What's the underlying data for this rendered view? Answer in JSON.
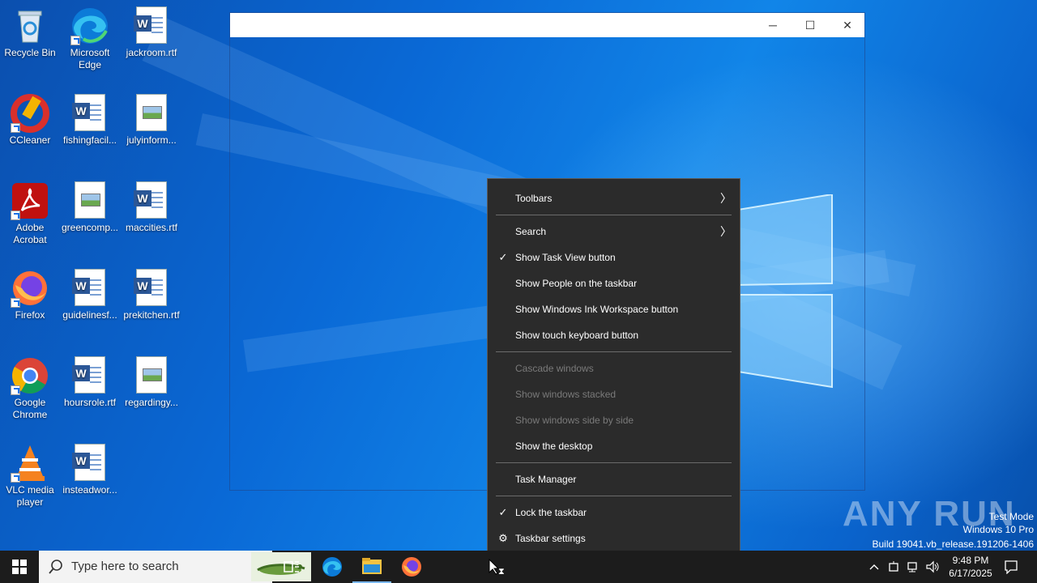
{
  "desktop": {
    "icons": [
      {
        "label": "Recycle Bin",
        "icon": "recycle-bin-icon"
      },
      {
        "label": "Microsoft Edge",
        "icon": "edge-icon"
      },
      {
        "label": "jackroom.rtf",
        "icon": "word-document-icon"
      },
      {
        "label": "CCleaner",
        "icon": "ccleaner-icon"
      },
      {
        "label": "fishingfacil...",
        "icon": "word-document-icon"
      },
      {
        "label": "julyinform...",
        "icon": "image-file-icon"
      },
      {
        "label": "Adobe Acrobat",
        "icon": "acrobat-icon"
      },
      {
        "label": "greencomp...",
        "icon": "image-file-icon"
      },
      {
        "label": "maccities.rtf",
        "icon": "word-document-icon"
      },
      {
        "label": "Firefox",
        "icon": "firefox-icon"
      },
      {
        "label": "guidelinesf...",
        "icon": "word-document-icon"
      },
      {
        "label": "prekitchen.rtf",
        "icon": "word-document-icon"
      },
      {
        "label": "Google Chrome",
        "icon": "chrome-icon"
      },
      {
        "label": "hoursrole.rtf",
        "icon": "word-document-icon"
      },
      {
        "label": "regardingy...",
        "icon": "image-file-icon"
      },
      {
        "label": "VLC media player",
        "icon": "vlc-icon"
      },
      {
        "label": "insteadwor...",
        "icon": "word-document-icon"
      }
    ]
  },
  "window": {
    "minimize_glyph": "─",
    "maximize_glyph": "☐",
    "close_glyph": "✕"
  },
  "context_menu": {
    "items": [
      {
        "label": "Toolbars",
        "submenu": true,
        "checked": false,
        "disabled": false
      },
      {
        "label": "Search",
        "submenu": true,
        "checked": false,
        "disabled": false
      },
      {
        "label": "Show Task View button",
        "submenu": false,
        "checked": true,
        "disabled": false
      },
      {
        "label": "Show People on the taskbar",
        "submenu": false,
        "checked": false,
        "disabled": false
      },
      {
        "label": "Show Windows Ink Workspace button",
        "submenu": false,
        "checked": false,
        "disabled": false
      },
      {
        "label": "Show touch keyboard button",
        "submenu": false,
        "checked": false,
        "disabled": false
      },
      {
        "label": "Cascade windows",
        "submenu": false,
        "checked": false,
        "disabled": true
      },
      {
        "label": "Show windows stacked",
        "submenu": false,
        "checked": false,
        "disabled": true
      },
      {
        "label": "Show windows side by side",
        "submenu": false,
        "checked": false,
        "disabled": true
      },
      {
        "label": "Show the desktop",
        "submenu": false,
        "checked": false,
        "disabled": false
      },
      {
        "label": "Task Manager",
        "submenu": false,
        "checked": false,
        "disabled": false
      },
      {
        "label": "Lock the taskbar",
        "submenu": false,
        "checked": true,
        "disabled": false
      },
      {
        "label": "Taskbar settings",
        "submenu": false,
        "checked": false,
        "disabled": false
      }
    ],
    "check_glyph": "✓",
    "arrow_glyph": "〉",
    "gear_glyph": "⚙"
  },
  "watermark": {
    "brand": "ANY RUN",
    "line1": "Test Mode",
    "line2": "Windows 10 Pro",
    "line3": "Build 19041.vb_release.191206-1406"
  },
  "taskbar": {
    "search_placeholder": "Type here to search",
    "time": "9:48 PM",
    "date": "6/17/2025",
    "pinned": [
      "task-view-icon",
      "edge-icon",
      "file-explorer-icon",
      "firefox-icon"
    ]
  },
  "colors": {
    "taskbar": "#1c1c1c",
    "menu_bg": "#2b2b2b",
    "desktop_blue": "#0a69d6"
  }
}
